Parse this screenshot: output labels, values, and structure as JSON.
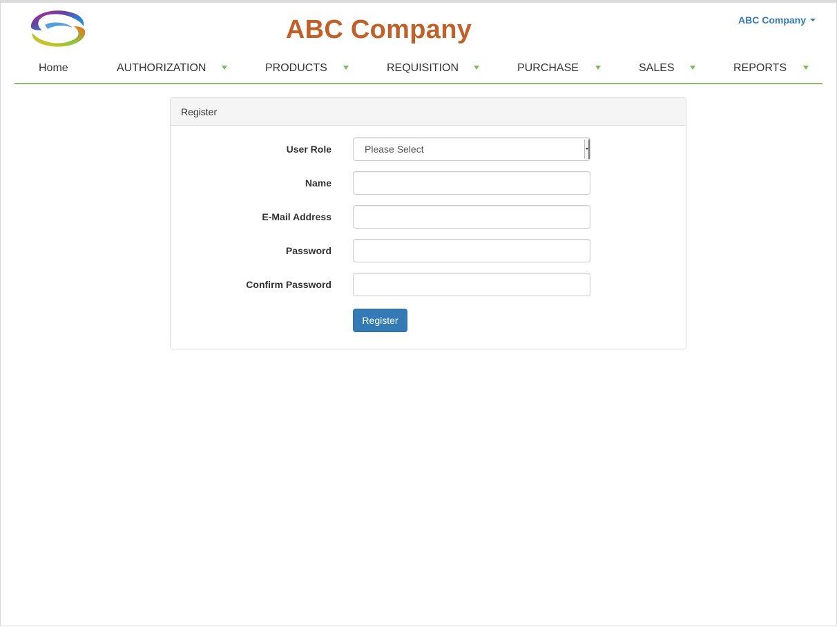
{
  "header": {
    "title": "ABC Company",
    "company_menu_label": "ABC Company"
  },
  "nav": {
    "items": [
      {
        "label": "Home",
        "has_dropdown": false
      },
      {
        "label": "AUTHORIZATION",
        "has_dropdown": true
      },
      {
        "label": "PRODUCTS",
        "has_dropdown": true
      },
      {
        "label": "REQUISITION",
        "has_dropdown": true
      },
      {
        "label": "PURCHASE",
        "has_dropdown": true
      },
      {
        "label": "SALES",
        "has_dropdown": true
      },
      {
        "label": "REPORTS",
        "has_dropdown": true
      }
    ]
  },
  "panel": {
    "heading": "Register",
    "fields": {
      "user_role": {
        "label": "User Role",
        "selected": "Please Select"
      },
      "name": {
        "label": "Name",
        "value": ""
      },
      "email": {
        "label": "E-Mail Address",
        "value": ""
      },
      "password": {
        "label": "Password",
        "value": ""
      },
      "confirm_password": {
        "label": "Confirm Password",
        "value": ""
      }
    },
    "submit_label": "Register"
  },
  "colors": {
    "brand_title": "#c0612a",
    "link": "#337ab7",
    "nav_accent": "#8fb86a",
    "primary_button": "#337ab7"
  }
}
